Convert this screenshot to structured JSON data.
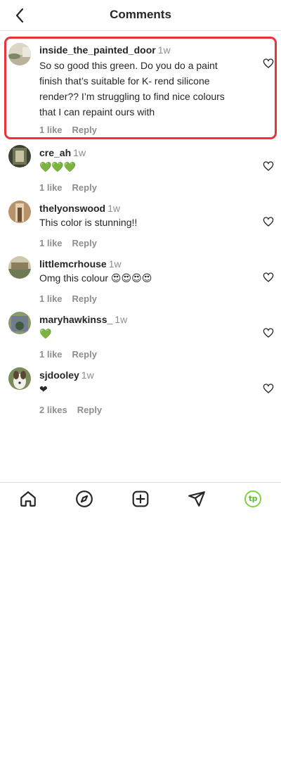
{
  "header": {
    "title": "Comments",
    "back_icon": "chevron-left-icon"
  },
  "comments": [
    {
      "username": "inside_the_painted_door",
      "time": "1w",
      "text": "So so good this green. Do you do a paint finish that’s suitable for K- rend silicone render?? I’m struggling to find nice colours that I can repaint ours with",
      "likes": "1 like",
      "reply": "Reply",
      "highlighted": true
    },
    {
      "username": "cre_ah",
      "time": "1w",
      "text": "💚💚💚",
      "likes": "1 like",
      "reply": "Reply"
    },
    {
      "username": "thelyonswood",
      "time": "1w",
      "text": "This color is stunning!!",
      "likes": "1 like",
      "reply": "Reply"
    },
    {
      "username": "littlemcrhouse",
      "time": "1w",
      "text": "Omg this colour 😍😍😍😍",
      "likes": "1 like",
      "reply": "Reply"
    },
    {
      "username": "maryhawkinss_",
      "time": "1w",
      "text": "💚",
      "likes": "1 like",
      "reply": "Reply"
    },
    {
      "username": "sjdooley",
      "time": "1w",
      "text": "❤",
      "likes": "2 likes",
      "reply": "Reply"
    }
  ],
  "nav": {
    "items": [
      "home-icon",
      "explore-compass-icon",
      "new-post-icon",
      "direct-message-icon",
      "profile-icon"
    ],
    "profile_initials": "tp"
  },
  "colors": {
    "highlight_border": "#e8323c",
    "secondary_text": "#8e8e8e",
    "primary_text": "#262626",
    "profile_accent": "#7dd33a"
  }
}
